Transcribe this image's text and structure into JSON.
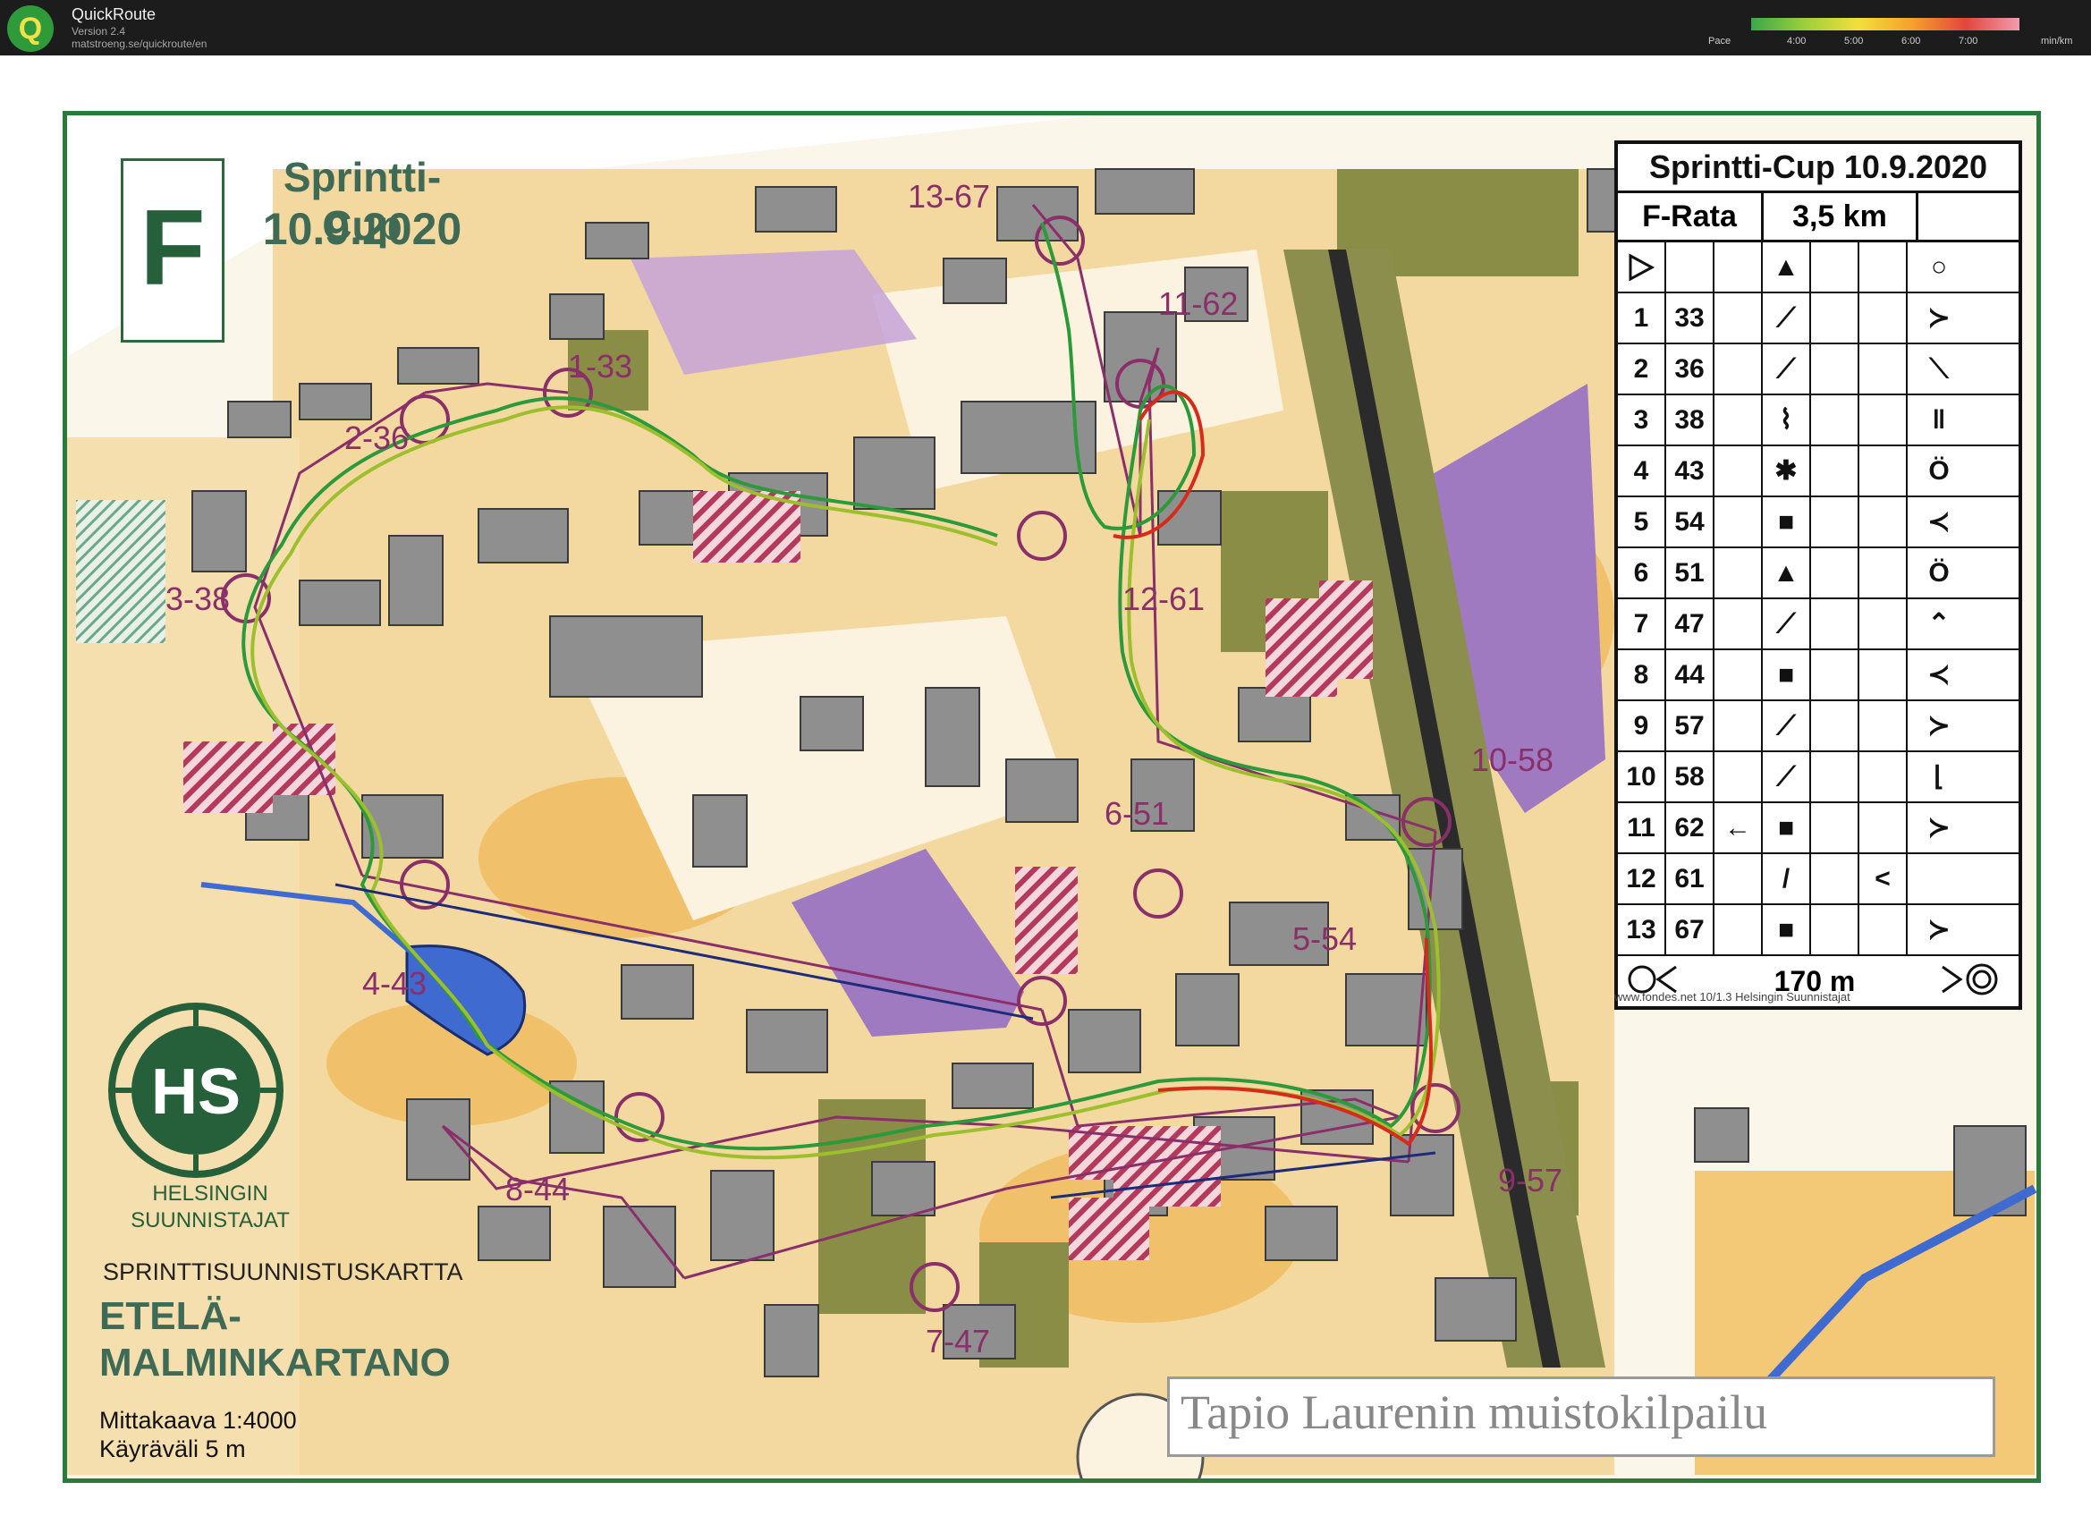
{
  "app": {
    "logo_letter": "Q",
    "name": "QuickRoute",
    "version": "Version 2.4",
    "url": "matstroeng.se/quickroute/en",
    "pace": {
      "label": "Pace",
      "ticks": [
        "4:00",
        "5:00",
        "6:00",
        "7:00"
      ],
      "unit": "min/km"
    }
  },
  "map": {
    "sheet_letter": "F",
    "event_title": "Sprintti-Cup",
    "event_date": "10.9.2020",
    "club_logo_text": "HS",
    "club_name_1": "HELSINGIN",
    "club_name_2": "SUUNNISTAJAT",
    "map_type": "SPRINTTISUUNNISTUSKARTTA",
    "area_name_1": "ETELÄ-",
    "area_name_2": "MALMINKARTANO",
    "scale": "Mittakaava 1:4000",
    "contour_interval": "Käyräväli 5 m",
    "memorial": "Tapio Laurenin muistokilpailu",
    "print_credit": "www.fondes.net 10/1.3 Helsingin Suunnistajat",
    "control_labels": [
      "1-33",
      "2-36",
      "3-38",
      "4-43",
      "5-54",
      "6-51",
      "7-47",
      "8-44",
      "9-57",
      "10-58",
      "11-62",
      "12-61",
      "13-67"
    ]
  },
  "control_card": {
    "title": "Sprintti-Cup 10.9.2020",
    "course_name": "F-Rata",
    "course_length": "3,5 km",
    "rows": [
      {
        "num": "",
        "code": "",
        "dir": "",
        "feature": "▲",
        "detail": "",
        "extra": "",
        "location": "○"
      },
      {
        "num": "1",
        "code": "33",
        "dir": "",
        "feature": "⟋",
        "detail": "",
        "extra": "",
        "location": "≻"
      },
      {
        "num": "2",
        "code": "36",
        "dir": "",
        "feature": "⟋",
        "detail": "",
        "extra": "",
        "location": "⟍"
      },
      {
        "num": "3",
        "code": "38",
        "dir": "",
        "feature": "⌇",
        "detail": "",
        "extra": "",
        "location": "‖"
      },
      {
        "num": "4",
        "code": "43",
        "dir": "",
        "feature": "✱",
        "detail": "",
        "extra": "",
        "location": "Ö"
      },
      {
        "num": "5",
        "code": "54",
        "dir": "",
        "feature": "■",
        "detail": "",
        "extra": "",
        "location": "≺"
      },
      {
        "num": "6",
        "code": "51",
        "dir": "",
        "feature": "▲",
        "detail": "",
        "extra": "",
        "location": "Ö"
      },
      {
        "num": "7",
        "code": "47",
        "dir": "",
        "feature": "⟋",
        "detail": "",
        "extra": "",
        "location": "⌃"
      },
      {
        "num": "8",
        "code": "44",
        "dir": "",
        "feature": "■",
        "detail": "",
        "extra": "",
        "location": "≺"
      },
      {
        "num": "9",
        "code": "57",
        "dir": "",
        "feature": "⟋",
        "detail": "",
        "extra": "",
        "location": "≻"
      },
      {
        "num": "10",
        "code": "58",
        "dir": "",
        "feature": "⟋",
        "detail": "",
        "extra": "",
        "location": "⌊"
      },
      {
        "num": "11",
        "code": "62",
        "dir": "←",
        "feature": "■",
        "detail": "",
        "extra": "",
        "location": "≻"
      },
      {
        "num": "12",
        "code": "61",
        "dir": "",
        "feature": "/",
        "detail": "",
        "extra": "<",
        "location": ""
      },
      {
        "num": "13",
        "code": "67",
        "dir": "",
        "feature": "■",
        "detail": "",
        "extra": "",
        "location": "≻"
      }
    ],
    "finish_distance": "170 m"
  },
  "colors": {
    "frame_green": "#2a7a3b",
    "building_grey": "#8a8a8a",
    "open_yellow": "#f3c877",
    "forest_olive": "#7b7e3d",
    "out_of_bounds_purple": "#a07ac0",
    "course_magenta": "#b0306a",
    "route_green": "#2c9a3a",
    "route_red": "#d82a1a",
    "route_navy": "#1e2a7a"
  }
}
